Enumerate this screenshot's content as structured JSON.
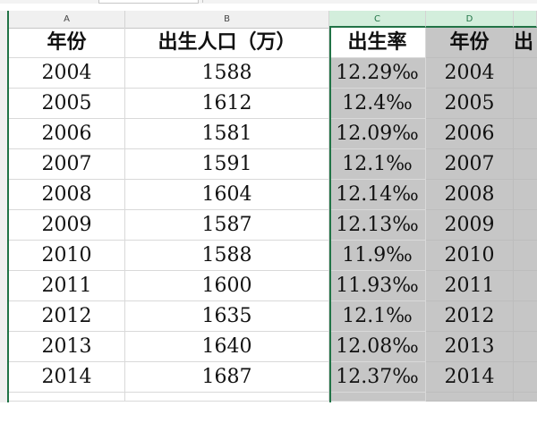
{
  "columns": [
    {
      "letter": "A",
      "selected": false
    },
    {
      "letter": "B",
      "selected": false
    },
    {
      "letter": "C",
      "selected": true
    },
    {
      "letter": "D",
      "selected": true
    }
  ],
  "headers": {
    "a": "年份",
    "b": "出生人口（万）",
    "c": "出生率",
    "d": "年份",
    "e": "出"
  },
  "rows": [
    {
      "year": "2004",
      "births": "1588",
      "rate": "12.29‰",
      "year2": "2004"
    },
    {
      "year": "2005",
      "births": "1612",
      "rate": "12.4‰",
      "year2": "2005"
    },
    {
      "year": "2006",
      "births": "1581",
      "rate": "12.09‰",
      "year2": "2006"
    },
    {
      "year": "2007",
      "births": "1591",
      "rate": "12.1‰",
      "year2": "2007"
    },
    {
      "year": "2008",
      "births": "1604",
      "rate": "12.14‰",
      "year2": "2008"
    },
    {
      "year": "2009",
      "births": "1587",
      "rate": "12.13‰",
      "year2": "2009"
    },
    {
      "year": "2010",
      "births": "1588",
      "rate": "11.9‰",
      "year2": "2010"
    },
    {
      "year": "2011",
      "births": "1600",
      "rate": "11.93‰",
      "year2": "2011"
    },
    {
      "year": "2012",
      "births": "1635",
      "rate": "12.1‰",
      "year2": "2012"
    },
    {
      "year": "2013",
      "births": "1640",
      "rate": "12.08‰",
      "year2": "2013"
    },
    {
      "year": "2014",
      "births": "1687",
      "rate": "12.37‰",
      "year2": "2014"
    }
  ],
  "colors": {
    "selection_border": "#217346",
    "selected_header_bg": "#d3eedc",
    "highlight_fill": "#c6c6c6"
  }
}
